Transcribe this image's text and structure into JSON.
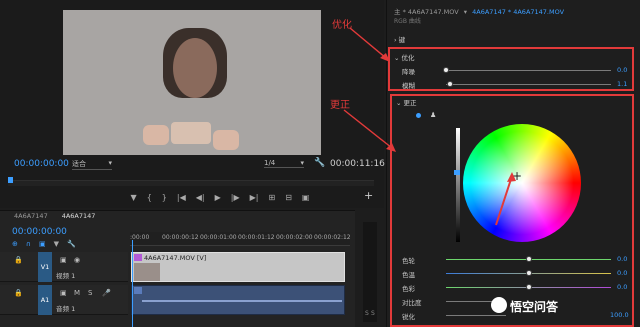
{
  "monitor": {
    "timecode_current": "00:00:00:00",
    "fit_label": "适合",
    "quality_label": "1/4",
    "timecode_total": "00:00:11:16"
  },
  "timeline": {
    "tabs": [
      "4A6A7147",
      "4A6A7147"
    ],
    "timecode": "00:00:00:00",
    "ruler": [
      ":00:00",
      "00:00:00:12",
      "00:00:01:00",
      "00:00:01:12",
      "00:00:02:00",
      "00:00:02:12"
    ],
    "tracks": [
      {
        "tag": "V1",
        "name": "视频 1"
      },
      {
        "tag": "A1",
        "name": "音频 1"
      }
    ],
    "clip_label": "4A6A7147.MOV [V]",
    "meter_marks": [
      "S",
      "S"
    ]
  },
  "panel": {
    "header_left": "主 * 4A6A7147.MOV",
    "header_right": "4A6A7147 * 4A6A7147.MOV",
    "sub_header": "RGB 曲线",
    "section_top": "键",
    "optimize": {
      "title": "优化",
      "rows": [
        {
          "label": "降噪",
          "value": "0.0",
          "level": 0.0
        },
        {
          "label": "模糊",
          "value": "1.1",
          "level": 0.02
        }
      ]
    },
    "correction": {
      "title": "更正",
      "sliders": [
        {
          "label": "色轮",
          "value": "0.0",
          "color": "#6dd66d"
        },
        {
          "label": "色温",
          "value": "0.0",
          "color": "#d8c24a"
        },
        {
          "label": "色彩",
          "value": "0.0",
          "color": "#b04ad8"
        },
        {
          "label": "对比度",
          "value": "0.0",
          "color": "#9a9a9a"
        },
        {
          "label": "锐化",
          "value": "100.0",
          "color": "#9a9a9a"
        }
      ]
    }
  },
  "annotations": {
    "optimize_label": "优化",
    "correction_label": "更正"
  },
  "watermark": "悟空问答"
}
